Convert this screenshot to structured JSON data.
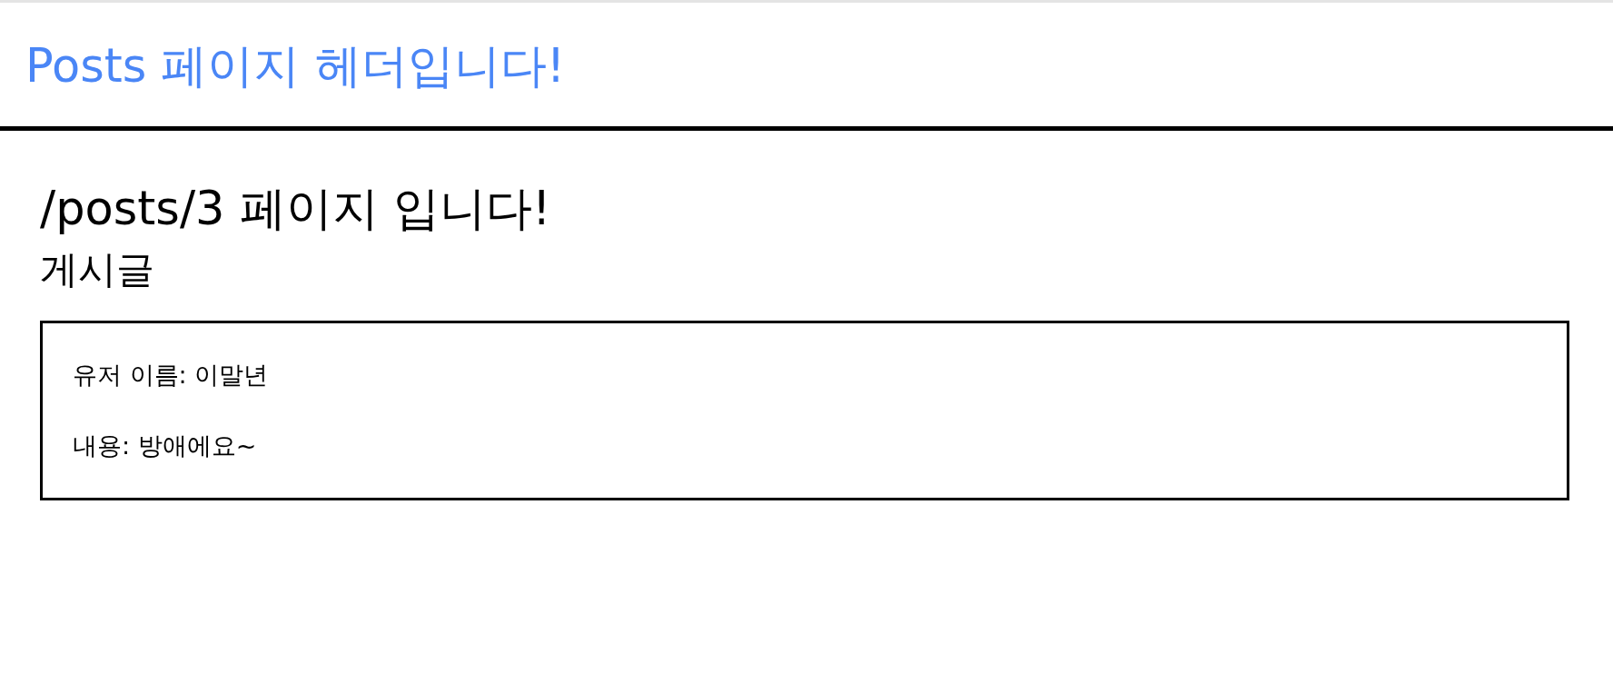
{
  "header": {
    "title": "Posts 페이지 헤더입니다!"
  },
  "page": {
    "heading": "/posts/3 페이지 입니다!",
    "subheading": "게시글"
  },
  "post": {
    "lines": [
      "유저 이름: 이말년",
      "내용: 방애에요~"
    ]
  }
}
